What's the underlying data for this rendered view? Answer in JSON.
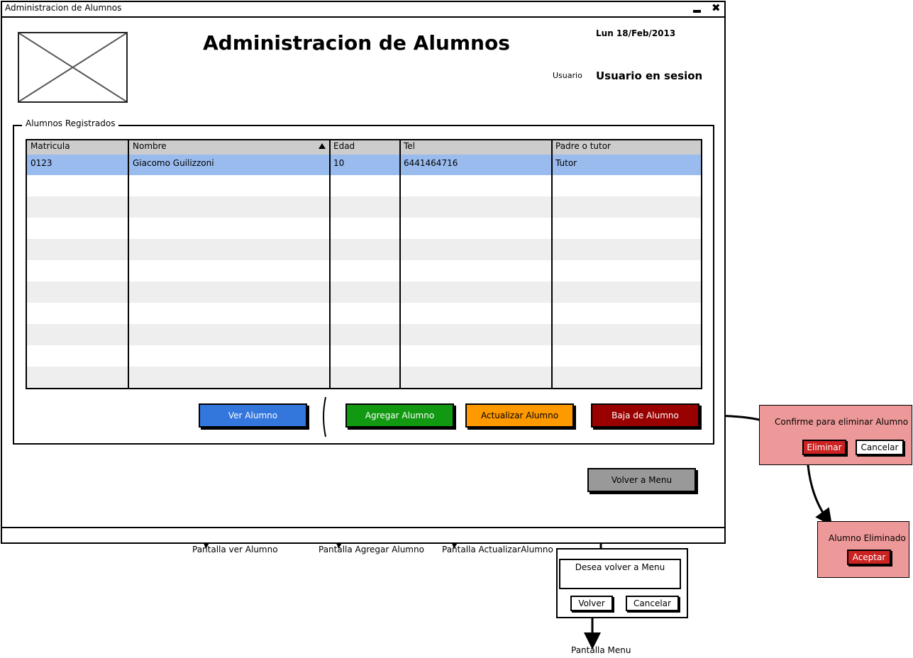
{
  "window": {
    "title": "Administracion de Alumnos",
    "min_icon": "minimize-icon",
    "close_icon": "close-icon",
    "close_glyph": "✖"
  },
  "header": {
    "heading": "Administracion de Alumnos",
    "date": "Lun 18/Feb/2013",
    "user_label": "Usuario",
    "user_value": "Usuario en sesion"
  },
  "group": {
    "legend": "Alumnos Registrados"
  },
  "table": {
    "columns": [
      "Matricula",
      "Nombre",
      "Edad",
      "Tel",
      "Padre o tutor"
    ],
    "sorted_column": "Nombre",
    "sort_icon": "sort-ascending-icon",
    "rows": [
      [
        "0123",
        "Giacomo Guilizzoni",
        "10",
        "6441464716",
        "Tutor"
      ]
    ]
  },
  "actions": {
    "ver": "Ver Alumno",
    "agregar": "Agregar Alumno",
    "actualizar": "Actualizar Alumno",
    "baja": "Baja de Alumno",
    "volver_menu": "Volver a Menu"
  },
  "colors": {
    "ver": "#3377dd",
    "agregar": "#119911",
    "actualizar": "#ff9900",
    "baja": "#990000",
    "volver": "#999999",
    "selected_row": "#99bbee",
    "confirm_red": "#cc2222",
    "panel_red": "#ee9999"
  },
  "notes": {
    "ver": "Pantalla ver Alumno",
    "agregar": "Pantalla Agregar Alumno",
    "actualizar": "Pantalla ActualizarAlumno",
    "menu": "Pantalla Menu"
  },
  "confirm_delete": {
    "message": "Confirme para eliminar Alumno",
    "ok": "Eliminar",
    "cancel": "Cancelar"
  },
  "deleted": {
    "message": "Alumno Eliminado",
    "ok": "Aceptar"
  },
  "menu_dialog": {
    "message": "Desea volver a Menu",
    "ok": "Volver",
    "cancel": "Cancelar"
  }
}
